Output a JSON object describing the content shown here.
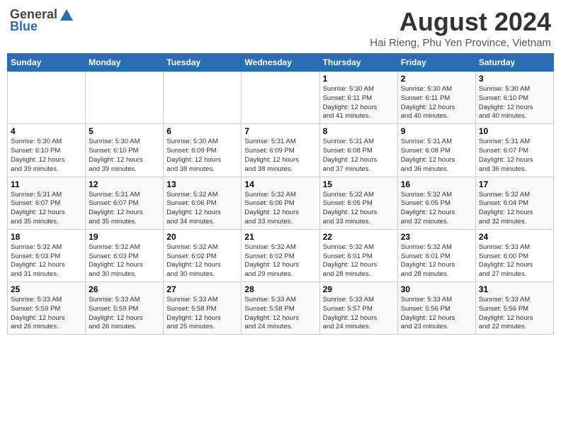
{
  "header": {
    "logo_general": "General",
    "logo_blue": "Blue",
    "title": "August 2024",
    "subtitle": "Hai Rieng, Phu Yen Province, Vietnam"
  },
  "calendar": {
    "days_of_week": [
      "Sunday",
      "Monday",
      "Tuesday",
      "Wednesday",
      "Thursday",
      "Friday",
      "Saturday"
    ],
    "weeks": [
      [
        {
          "day": "",
          "info": ""
        },
        {
          "day": "",
          "info": ""
        },
        {
          "day": "",
          "info": ""
        },
        {
          "day": "",
          "info": ""
        },
        {
          "day": "1",
          "info": "Sunrise: 5:30 AM\nSunset: 6:11 PM\nDaylight: 12 hours\nand 41 minutes."
        },
        {
          "day": "2",
          "info": "Sunrise: 5:30 AM\nSunset: 6:11 PM\nDaylight: 12 hours\nand 40 minutes."
        },
        {
          "day": "3",
          "info": "Sunrise: 5:30 AM\nSunset: 6:10 PM\nDaylight: 12 hours\nand 40 minutes."
        }
      ],
      [
        {
          "day": "4",
          "info": "Sunrise: 5:30 AM\nSunset: 6:10 PM\nDaylight: 12 hours\nand 39 minutes."
        },
        {
          "day": "5",
          "info": "Sunrise: 5:30 AM\nSunset: 6:10 PM\nDaylight: 12 hours\nand 39 minutes."
        },
        {
          "day": "6",
          "info": "Sunrise: 5:30 AM\nSunset: 6:09 PM\nDaylight: 12 hours\nand 38 minutes."
        },
        {
          "day": "7",
          "info": "Sunrise: 5:31 AM\nSunset: 6:09 PM\nDaylight: 12 hours\nand 38 minutes."
        },
        {
          "day": "8",
          "info": "Sunrise: 5:31 AM\nSunset: 6:08 PM\nDaylight: 12 hours\nand 37 minutes."
        },
        {
          "day": "9",
          "info": "Sunrise: 5:31 AM\nSunset: 6:08 PM\nDaylight: 12 hours\nand 36 minutes."
        },
        {
          "day": "10",
          "info": "Sunrise: 5:31 AM\nSunset: 6:07 PM\nDaylight: 12 hours\nand 36 minutes."
        }
      ],
      [
        {
          "day": "11",
          "info": "Sunrise: 5:31 AM\nSunset: 6:07 PM\nDaylight: 12 hours\nand 35 minutes."
        },
        {
          "day": "12",
          "info": "Sunrise: 5:31 AM\nSunset: 6:07 PM\nDaylight: 12 hours\nand 35 minutes."
        },
        {
          "day": "13",
          "info": "Sunrise: 5:32 AM\nSunset: 6:06 PM\nDaylight: 12 hours\nand 34 minutes."
        },
        {
          "day": "14",
          "info": "Sunrise: 5:32 AM\nSunset: 6:06 PM\nDaylight: 12 hours\nand 33 minutes."
        },
        {
          "day": "15",
          "info": "Sunrise: 5:32 AM\nSunset: 6:05 PM\nDaylight: 12 hours\nand 33 minutes."
        },
        {
          "day": "16",
          "info": "Sunrise: 5:32 AM\nSunset: 6:05 PM\nDaylight: 12 hours\nand 32 minutes."
        },
        {
          "day": "17",
          "info": "Sunrise: 5:32 AM\nSunset: 6:04 PM\nDaylight: 12 hours\nand 32 minutes."
        }
      ],
      [
        {
          "day": "18",
          "info": "Sunrise: 5:32 AM\nSunset: 6:03 PM\nDaylight: 12 hours\nand 31 minutes."
        },
        {
          "day": "19",
          "info": "Sunrise: 5:32 AM\nSunset: 6:03 PM\nDaylight: 12 hours\nand 30 minutes."
        },
        {
          "day": "20",
          "info": "Sunrise: 5:32 AM\nSunset: 6:02 PM\nDaylight: 12 hours\nand 30 minutes."
        },
        {
          "day": "21",
          "info": "Sunrise: 5:32 AM\nSunset: 6:02 PM\nDaylight: 12 hours\nand 29 minutes."
        },
        {
          "day": "22",
          "info": "Sunrise: 5:32 AM\nSunset: 6:01 PM\nDaylight: 12 hours\nand 28 minutes."
        },
        {
          "day": "23",
          "info": "Sunrise: 5:32 AM\nSunset: 6:01 PM\nDaylight: 12 hours\nand 28 minutes."
        },
        {
          "day": "24",
          "info": "Sunrise: 5:33 AM\nSunset: 6:00 PM\nDaylight: 12 hours\nand 27 minutes."
        }
      ],
      [
        {
          "day": "25",
          "info": "Sunrise: 5:33 AM\nSunset: 5:59 PM\nDaylight: 12 hours\nand 26 minutes."
        },
        {
          "day": "26",
          "info": "Sunrise: 5:33 AM\nSunset: 5:59 PM\nDaylight: 12 hours\nand 26 minutes."
        },
        {
          "day": "27",
          "info": "Sunrise: 5:33 AM\nSunset: 5:58 PM\nDaylight: 12 hours\nand 25 minutes."
        },
        {
          "day": "28",
          "info": "Sunrise: 5:33 AM\nSunset: 5:58 PM\nDaylight: 12 hours\nand 24 minutes."
        },
        {
          "day": "29",
          "info": "Sunrise: 5:33 AM\nSunset: 5:57 PM\nDaylight: 12 hours\nand 24 minutes."
        },
        {
          "day": "30",
          "info": "Sunrise: 5:33 AM\nSunset: 5:56 PM\nDaylight: 12 hours\nand 23 minutes."
        },
        {
          "day": "31",
          "info": "Sunrise: 5:33 AM\nSunset: 5:56 PM\nDaylight: 12 hours\nand 22 minutes."
        }
      ]
    ]
  }
}
